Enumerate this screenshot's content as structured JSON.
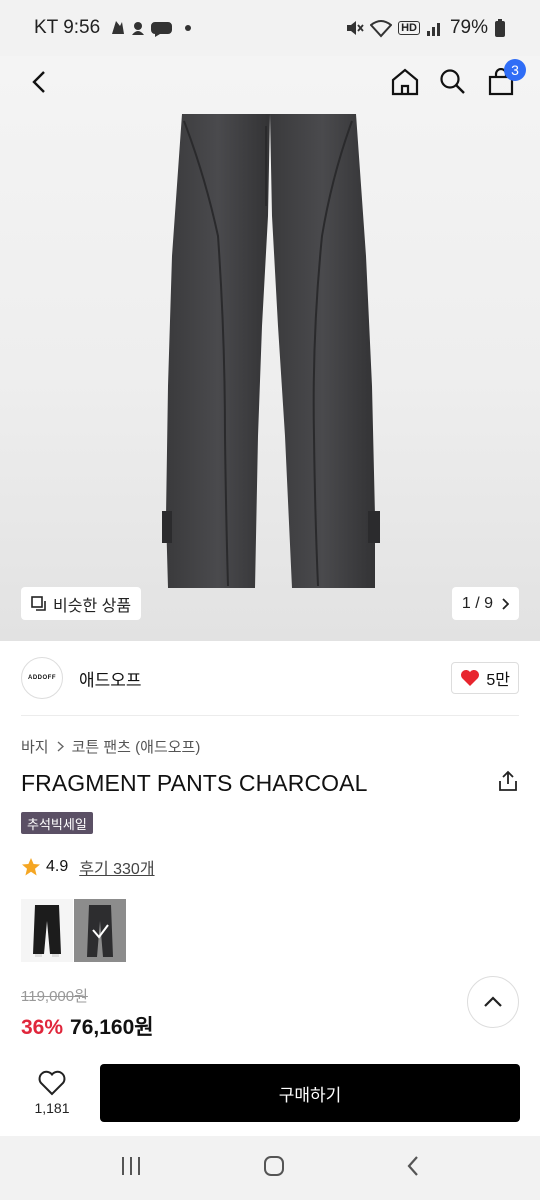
{
  "status_bar": {
    "carrier_time": "KT 9:56",
    "battery": "79%",
    "hd_label": "HD"
  },
  "gallery": {
    "similar_label": "비슷한 상품",
    "pager": "1 / 9"
  },
  "nav": {
    "cart_count": "3"
  },
  "brand": {
    "logo_text": "ADDOFF",
    "name": "애드오프",
    "likes": "5만"
  },
  "breadcrumb": {
    "level1": "바지",
    "level2": "코튼 팬츠 (애드오프)"
  },
  "product": {
    "title": "FRAGMENT PANTS CHARCOAL",
    "tag": "추석빅세일",
    "rating": "4.9",
    "reviews": "후기 330개",
    "original_price": "119,000원",
    "discount": "36%",
    "price": "76,160원"
  },
  "action_bar": {
    "wish_count": "1,181",
    "buy_label": "구매하기"
  },
  "colors": {
    "accent": "#2f6df6",
    "discount": "#e0263b",
    "heart": "#e8252e",
    "star": "#f5a623",
    "tag_bg": "#5b5065"
  }
}
